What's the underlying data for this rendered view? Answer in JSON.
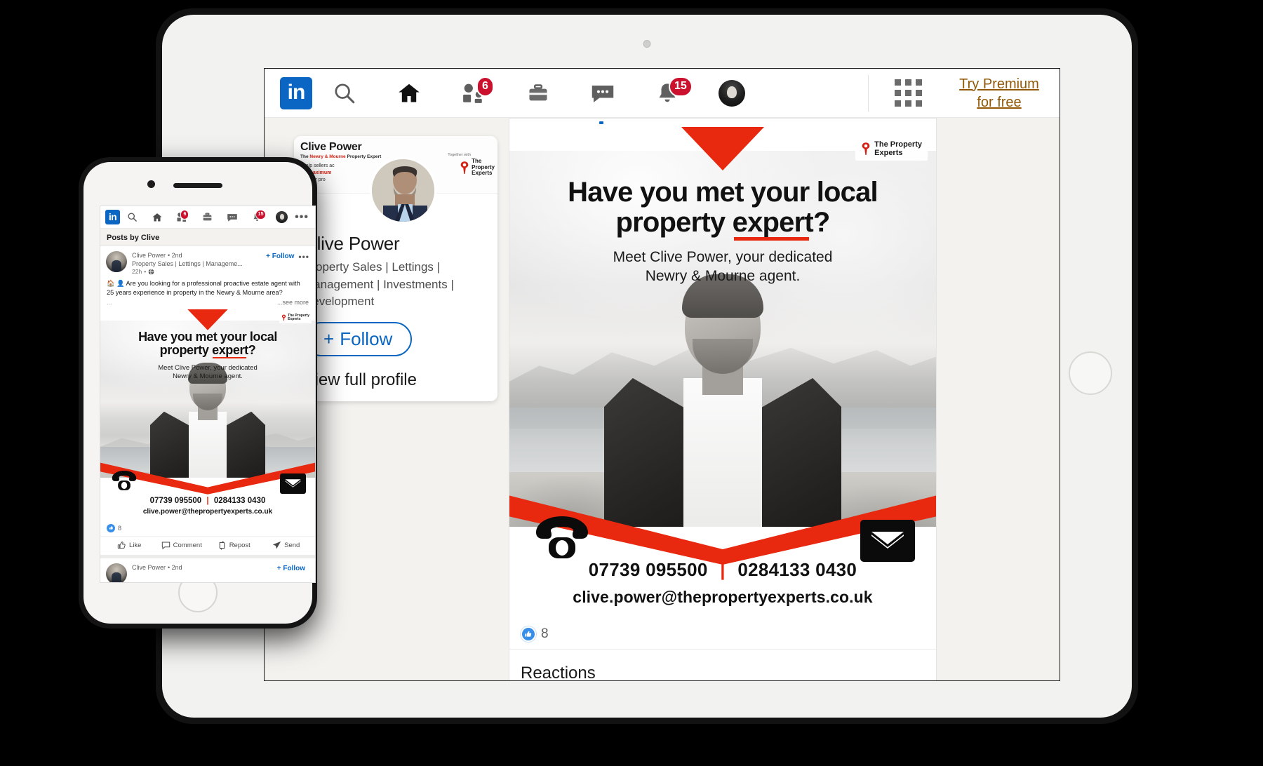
{
  "nav": {
    "logo_text": "in",
    "icons": [
      {
        "name": "search-icon",
        "label": "Search",
        "badge": null
      },
      {
        "name": "home-icon",
        "label": "Home",
        "badge": null
      },
      {
        "name": "my-network-icon",
        "label": "My Network",
        "badge": "6"
      },
      {
        "name": "jobs-icon",
        "label": "Jobs",
        "badge": null
      },
      {
        "name": "messaging-icon",
        "label": "Messaging",
        "badge": null
      },
      {
        "name": "notifications-icon",
        "label": "Notifications",
        "badge": "15"
      },
      {
        "name": "me-avatar",
        "label": "Me",
        "badge": null
      }
    ],
    "work_grid_label": "Work",
    "premium_link": "Try Premium for free"
  },
  "profile_card": {
    "banner": {
      "name": "Clive Power",
      "tagline_pre": "The ",
      "tagline_accent": "Newry & Mourne",
      "tagline_post": " Property Expert",
      "body_line1": "I help sellers ac",
      "body_line2_pre": "the ",
      "body_line2_accent": "maximum",
      "body_line3": "for their pro",
      "together_with": "Together with",
      "logo_line1": "The",
      "logo_line2": "Property",
      "logo_line3": "Experts"
    },
    "name": "Clive Power",
    "headline": "Property Sales | Lettings | Management | Investments | Development",
    "follow_label": "Follow",
    "follow_plus": "+",
    "view_profile_label": "View full profile"
  },
  "post": {
    "creative": {
      "logo_line1": "The Property",
      "logo_line2": "Experts",
      "headline_line1": "Have you met your local",
      "headline_line2_pre": "property ",
      "headline_line2_underlined": "expert",
      "headline_line2_post": "?",
      "subhead_line1": "Meet Clive Power, your dedicated",
      "subhead_line2": "Newry & Mourne agent.",
      "phone_mobile": "07739 095500",
      "phone_separator": "|",
      "phone_landline": "0284133 0430",
      "email": "clive.power@thepropertyexperts.co.uk"
    },
    "reaction_count": "8",
    "reactions_heading": "Reactions"
  },
  "phone": {
    "section_title": "Posts by Clive",
    "post": {
      "author": "Clive Power",
      "degree": "• 2nd",
      "headline": "Property Sales | Lettings | Manageme...",
      "time": "22h",
      "follow_label": "+ Follow",
      "body": "🏠 👤 Are you looking for a professional proactive estate agent with 25 years experience in property in the Newry & Mourne area?",
      "see_more": "...see more",
      "ellipsis_left": "...",
      "reaction_count": "8",
      "actions": [
        {
          "name": "like-button",
          "label": "Like"
        },
        {
          "name": "comment-button",
          "label": "Comment"
        },
        {
          "name": "repost-button",
          "label": "Repost"
        },
        {
          "name": "send-button",
          "label": "Send"
        }
      ]
    },
    "next_post": {
      "author": "Clive Power",
      "degree": "• 2nd",
      "follow_label": "+ Follow"
    }
  },
  "colors": {
    "linkedin_blue": "#0a66c2",
    "brand_red": "#e8280f",
    "badge_red": "#cb112d",
    "premium_gold": "#915907"
  }
}
